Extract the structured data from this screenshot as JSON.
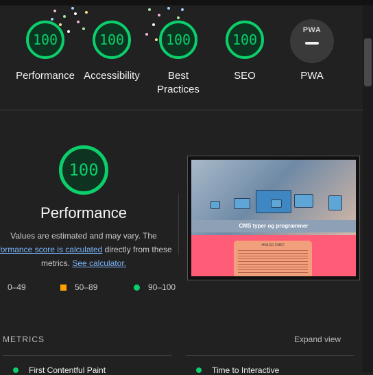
{
  "categories": [
    {
      "label_line1": "Performance",
      "label_line2": "",
      "score": "100"
    },
    {
      "label_line1": "Accessibility",
      "label_line2": "",
      "score": "100"
    },
    {
      "label_line1": "Best",
      "label_line2": "Practices",
      "score": "100"
    },
    {
      "label_line1": "SEO",
      "label_line2": "",
      "score": "100"
    }
  ],
  "pwa": {
    "badge_text": "PWA",
    "label": "PWA"
  },
  "performance_section": {
    "score": "100",
    "title": "Performance",
    "desc_line1": "Values are estimated and may vary. The",
    "desc_link1": "rformance score is calculated",
    "desc_line2_rest": " directly from these",
    "desc_line3_pre": "metrics. ",
    "desc_link2": "See calculator."
  },
  "legend": [
    {
      "range": "0–49",
      "color": "#ff4e42"
    },
    {
      "range": "50–89",
      "color": "#ffa400"
    },
    {
      "range": "90–100",
      "color": "#0cce6b"
    }
  ],
  "screenshot": {
    "heading": "CMS typer og programmer",
    "card_title": "HVA ER CMS?"
  },
  "metrics": {
    "section_title": "METRICS",
    "expand_label": "Expand view",
    "items": [
      {
        "label": "First Contentful Paint",
        "color": "#0cce6b"
      },
      {
        "label": "Time to Interactive",
        "color": "#0cce6b"
      }
    ]
  }
}
